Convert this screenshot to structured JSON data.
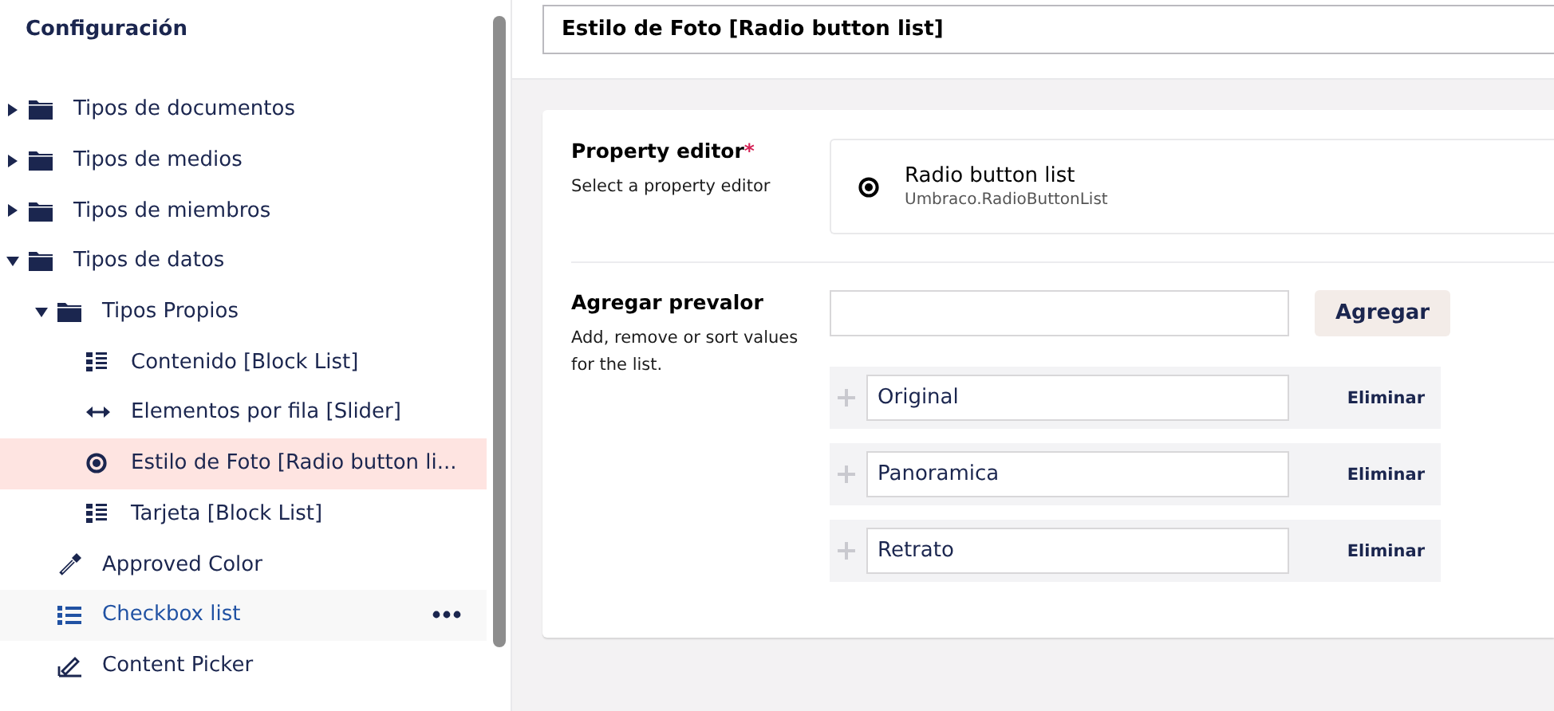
{
  "sidebar": {
    "title": "Configuración",
    "tree": [
      {
        "label": "Tipos de documentos",
        "kind": "folder",
        "expanded": false,
        "selected": false,
        "hovered": false
      },
      {
        "label": "Tipos de medios",
        "kind": "folder",
        "expanded": false,
        "selected": false,
        "hovered": false
      },
      {
        "label": "Tipos de miembros",
        "kind": "folder",
        "expanded": false,
        "selected": false,
        "hovered": false
      },
      {
        "label": "Tipos de datos",
        "kind": "folder",
        "expanded": true,
        "selected": false,
        "hovered": false,
        "children": [
          {
            "label": "Tipos Propios",
            "kind": "folder",
            "expanded": true,
            "selected": false,
            "hovered": false,
            "children": [
              {
                "label": "Contenido [Block List]",
                "kind": "blocklist",
                "selected": false,
                "hovered": false
              },
              {
                "label": "Elementos por fila [Slider]",
                "kind": "slider",
                "selected": false,
                "hovered": false
              },
              {
                "label": "Estilo de Foto [Radio button li...",
                "kind": "radio",
                "selected": true,
                "hovered": false
              },
              {
                "label": "Tarjeta [Block List]",
                "kind": "blocklist",
                "selected": false,
                "hovered": false
              }
            ]
          },
          {
            "label": "Approved Color",
            "kind": "eyedropper",
            "selected": false,
            "hovered": false
          },
          {
            "label": "Checkbox list",
            "kind": "list",
            "selected": false,
            "hovered": true
          },
          {
            "label": "Content Picker",
            "kind": "picker",
            "selected": false,
            "hovered": false
          }
        ]
      }
    ]
  },
  "editor": {
    "name": "Estilo de Foto [Radio button list]",
    "property_editor": {
      "label": "Property editor",
      "required_mark": "*",
      "description": "Select a property editor",
      "name": "Radio button list",
      "alias": "Umbraco.RadioButtonList"
    },
    "prevalues": {
      "label": "Agregar prevalor",
      "description": "Add, remove or sort values for the list.",
      "add_button": "Agregar",
      "items": [
        {
          "value": "Original",
          "remove": "Eliminar"
        },
        {
          "value": "Panoramica",
          "remove": "Eliminar"
        },
        {
          "value": "Retrato",
          "remove": "Eliminar"
        }
      ]
    }
  }
}
